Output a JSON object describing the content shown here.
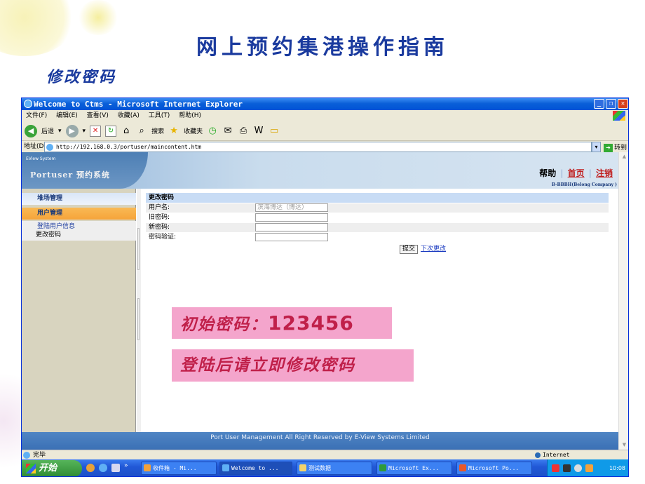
{
  "slide": {
    "title": "网上预约集港操作指南",
    "subtitle": "修改密码"
  },
  "browser": {
    "title": "Welcome to Ctms - Microsoft Internet Explorer",
    "menu": [
      "文件(F)",
      "编辑(E)",
      "查看(V)",
      "收藏(A)",
      "工具(T)",
      "帮助(H)"
    ],
    "toolbar": {
      "back": "后退",
      "search": "搜索",
      "favorites": "收藏夹"
    },
    "address_label": "地址(D)",
    "address": "http://192.168.0.3/portuser/maincontent.htm",
    "go": "转到",
    "status": "完毕",
    "zone": "Internet"
  },
  "app": {
    "eview": "EView System",
    "system_name": "Portuser 预约系统",
    "help": "帮助",
    "home": "首页",
    "logout": "注销",
    "company": "B-BBBH(Belong Company )",
    "nav": {
      "group1": "堆场管理",
      "group2": "用户管理",
      "items": [
        "登陆用户信息",
        "更改密码"
      ]
    },
    "form": {
      "header": "更改密码",
      "rows": [
        {
          "label": "用户名:",
          "value": "滨海博达（博达）"
        },
        {
          "label": "旧密码:",
          "value": ""
        },
        {
          "label": "新密码:",
          "value": ""
        },
        {
          "label": "密码验证:",
          "value": ""
        }
      ],
      "submit": "提交",
      "next": "下次更改"
    },
    "footer": "Port User Management    All Right Reserved by E-View Systems Limited"
  },
  "callouts": {
    "initial_label": "初始密码：",
    "initial_value": "123456",
    "advice": "登陆后请立即修改密码"
  },
  "taskbar": {
    "start": "开始",
    "tasks": [
      "收件箱 - Mi...",
      "Welcome to ...",
      "测试数据",
      "Microsoft Ex...",
      "Microsoft Po..."
    ],
    "clock": "10:08"
  },
  "colors": {
    "title_blue": "#1a3a9e",
    "callout_bg": "#f4a5cc",
    "callout_text": "#c0204a",
    "xp_blue": "#0053d6"
  }
}
